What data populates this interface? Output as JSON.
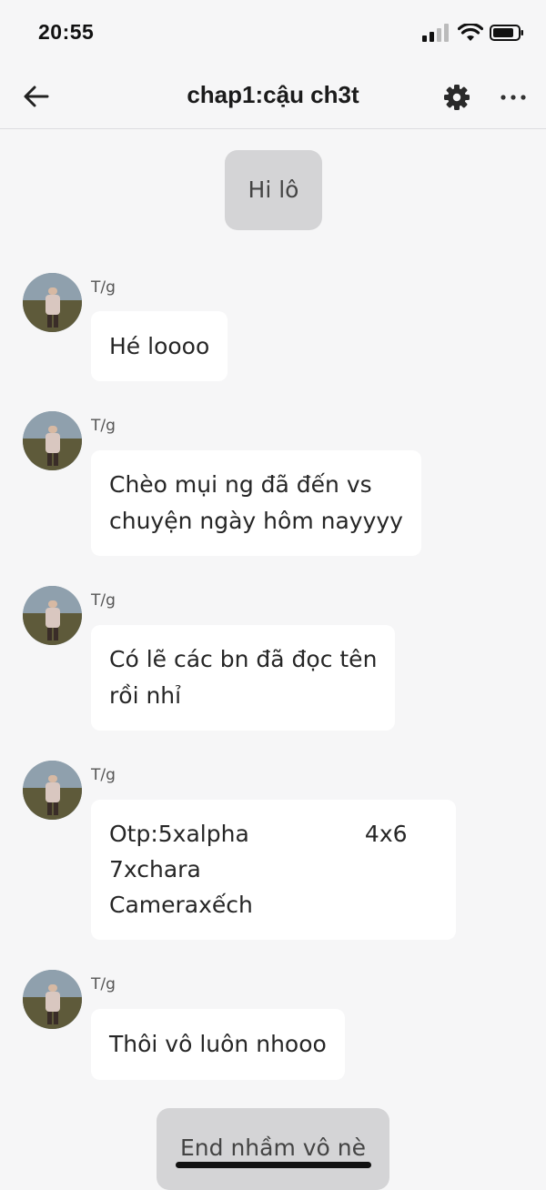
{
  "status_bar": {
    "time": "20:55",
    "icons": [
      "signal-icon",
      "wifi-icon",
      "battery-icon"
    ]
  },
  "nav": {
    "title": "chap1:cậu ch3t",
    "icons": [
      "back-arrow-icon",
      "gear-icon",
      "more-icon"
    ]
  },
  "chat": {
    "intro": "Hi lô",
    "messages": [
      {
        "sender": "T/g",
        "text": "Hé loooo"
      },
      {
        "sender": "T/g",
        "text": "Chèo mụi ng đã đến vs\nchuyện ngày hôm nayyyy"
      },
      {
        "sender": "T/g",
        "text": "Có lẽ các bn đã đọc tên\nrồi nhỉ"
      },
      {
        "sender": "T/g",
        "text": "Otp:5xalpha                4x6\n7xchara\nCameraxếch"
      },
      {
        "sender": "T/g",
        "text": "Thôi vô luôn nhooo"
      }
    ],
    "outro": "End nhầm vô nè"
  },
  "colors": {
    "background": "#f6f6f7",
    "bubble": "#ffffff",
    "system_bubble": "#d4d4d6"
  }
}
